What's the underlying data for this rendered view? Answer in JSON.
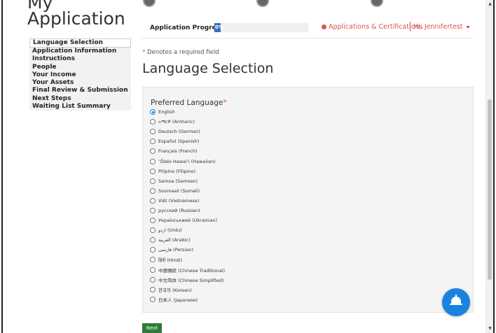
{
  "app": {
    "title": "My Application"
  },
  "sidebar": {
    "items": [
      {
        "label": "Language Selection"
      },
      {
        "label": "Application Information"
      },
      {
        "label": "Instructions"
      },
      {
        "label": "People"
      },
      {
        "label": "Your Income"
      },
      {
        "label": "Your Assets"
      },
      {
        "label": "Final Review & Submission"
      },
      {
        "label": "Next Steps"
      },
      {
        "label": "Waiting List Summary"
      }
    ]
  },
  "header": {
    "progress_label": "Application Progress",
    "progress_value": "0%",
    "progress_fraction": 0.07,
    "cert_link": "Applications & Certifications",
    "user_menu": "Hi, Jennifertest"
  },
  "form": {
    "required_star": "*",
    "required_note": " Denotes a required field",
    "page_title": "Language Selection",
    "language_label": "Preferred Language",
    "language_required_star": "*",
    "selected_language": "English",
    "languages": [
      {
        "label": "English"
      },
      {
        "label": "አማርኛ (Amharic)"
      },
      {
        "label": "Deutsch (German)"
      },
      {
        "label": "Español (Spanish)"
      },
      {
        "label": "Français (French)"
      },
      {
        "label": "ʻŌlelo Hawaiʻi (Hawaiian)"
      },
      {
        "label": "Pilipino (Filipino)"
      },
      {
        "label": "Samoa (Samoan)"
      },
      {
        "label": "Soomaali (Somali)"
      },
      {
        "label": "Việt (Vietnamese)"
      },
      {
        "label": "русский (Russian)"
      },
      {
        "label": "Українськиий (Ukrainian)"
      },
      {
        "label": "اردو (Urdu)"
      },
      {
        "label": "العربية (Arabic)"
      },
      {
        "label": "فارسی (Persian)"
      },
      {
        "label": "हिंदी (Hindi)"
      },
      {
        "label": "中國傳統 (Chinese Traditional)"
      },
      {
        "label": "中文简体 (Chinese Simplified)"
      },
      {
        "label": "한국의 (Korean)"
      },
      {
        "label": "日本人 (Japanese)"
      }
    ],
    "next_label": "Next"
  },
  "colors": {
    "accent": "#d9534f",
    "progress": "#3a6fc2",
    "fab": "#1a83e0",
    "next": "#2e7d32"
  },
  "icons": {
    "fab": "bell-icon",
    "user_menu": "caret-down-icon",
    "status": "status-dot-icon"
  }
}
